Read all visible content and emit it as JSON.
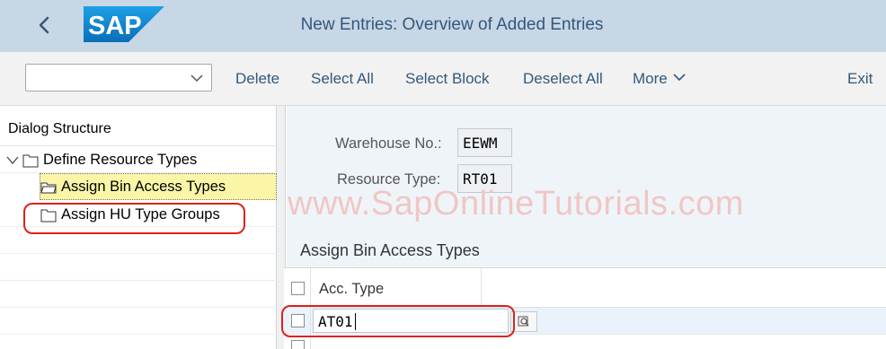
{
  "header": {
    "title": "New Entries: Overview of Added Entries",
    "logo_text": "SAP"
  },
  "toolbar": {
    "dropdown_value": "",
    "delete": "Delete",
    "select_all": "Select All",
    "select_block": "Select Block",
    "deselect_all": "Deselect All",
    "more": "More",
    "exit": "Exit"
  },
  "dialog_structure": {
    "title": "Dialog Structure",
    "items": [
      {
        "label": "Define Resource Types",
        "level": 0,
        "expanded": true
      },
      {
        "label": "Assign Bin Access Types",
        "level": 1,
        "selected": true
      },
      {
        "label": "Assign HU Type Groups",
        "level": 1
      }
    ]
  },
  "fields": {
    "warehouse_label": "Warehouse No.:",
    "warehouse_value": "EEWM",
    "resource_type_label": "Resource Type:",
    "resource_type_value": "RT01"
  },
  "watermark": "www.SapOnlineTutorials.com",
  "table": {
    "title": "Assign Bin Access Types",
    "columns": [
      "Acc. Type"
    ],
    "rows": [
      {
        "acc_type": "AT01"
      }
    ]
  },
  "colors": {
    "header_bg": "#c8d7e6",
    "accent_blue": "#32587a",
    "highlight_red": "#e0201a",
    "selected_row": "#fbf5a7"
  }
}
